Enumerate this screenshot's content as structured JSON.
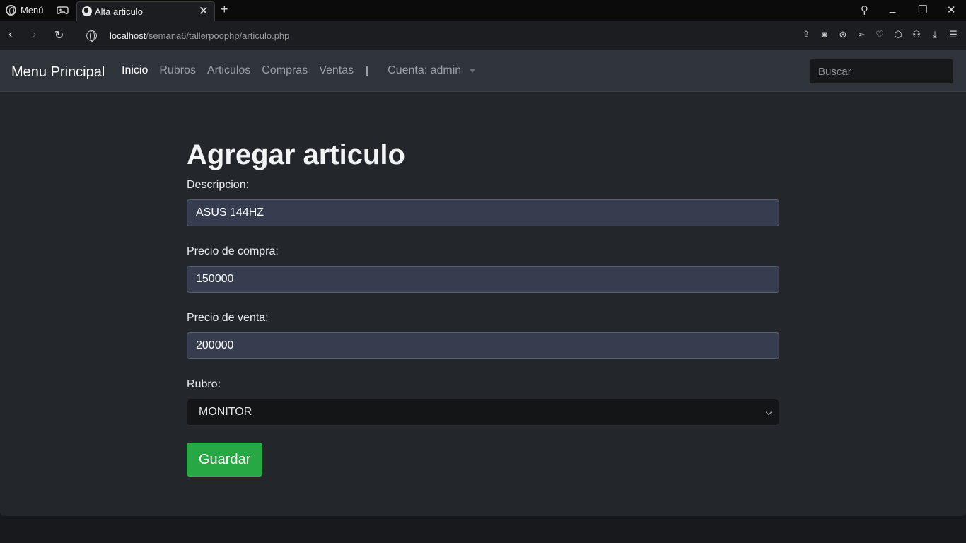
{
  "browser": {
    "menu_label": "Menú",
    "tab_title": "Alta articulo",
    "url_host": "localhost",
    "url_path": "/semana6/tallerpoophp/articulo.php"
  },
  "navbar": {
    "brand": "Menu Principal",
    "links": [
      "Inicio",
      "Rubros",
      "Articulos",
      "Compras",
      "Ventas"
    ],
    "account": "Cuenta: admin",
    "search_placeholder": "Buscar"
  },
  "form": {
    "title": "Agregar articulo",
    "descripcion_label": "Descripcion:",
    "descripcion_value": "ASUS 144HZ",
    "precio_compra_label": "Precio de compra:",
    "precio_compra_value": "150000",
    "precio_venta_label": "Precio de venta:",
    "precio_venta_value": "200000",
    "rubro_label": "Rubro:",
    "rubro_selected": "MONITOR",
    "save_label": "Guardar"
  },
  "colors": {
    "accent_green": "#28a745",
    "navbar_bg": "#2f333a",
    "page_bg": "#23262b"
  }
}
